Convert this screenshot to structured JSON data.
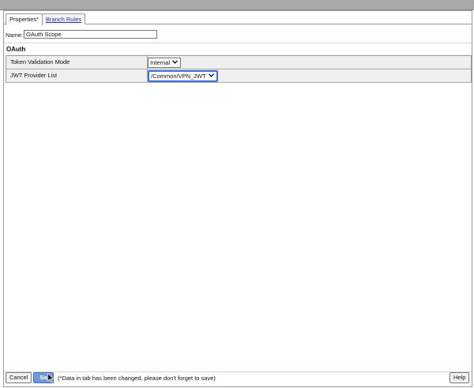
{
  "tabs": [
    {
      "label": "Properties*",
      "active": true
    },
    {
      "label": "Branch Rules",
      "active": false
    }
  ],
  "name_field": {
    "label": "Name:",
    "value": "OAuth Scope"
  },
  "section": {
    "title": "OAuth"
  },
  "rows": [
    {
      "label": "Token Validation Mode",
      "value": "Internal"
    },
    {
      "label": "JWT Provider List",
      "value": "/Common/VPN_JWT"
    }
  ],
  "footer": {
    "cancel_label": "Cancel",
    "save_label": "Sa",
    "notice": "(*Data in tab has been changed, please don't forget to save)",
    "help_label": "Help"
  },
  "colors": {
    "accent": "#3a6fd1",
    "save_button": "#6f99d8",
    "link": "#2233aa"
  },
  "icons": [
    "chevron-down-icon",
    "mouse-pointer-icon"
  ]
}
